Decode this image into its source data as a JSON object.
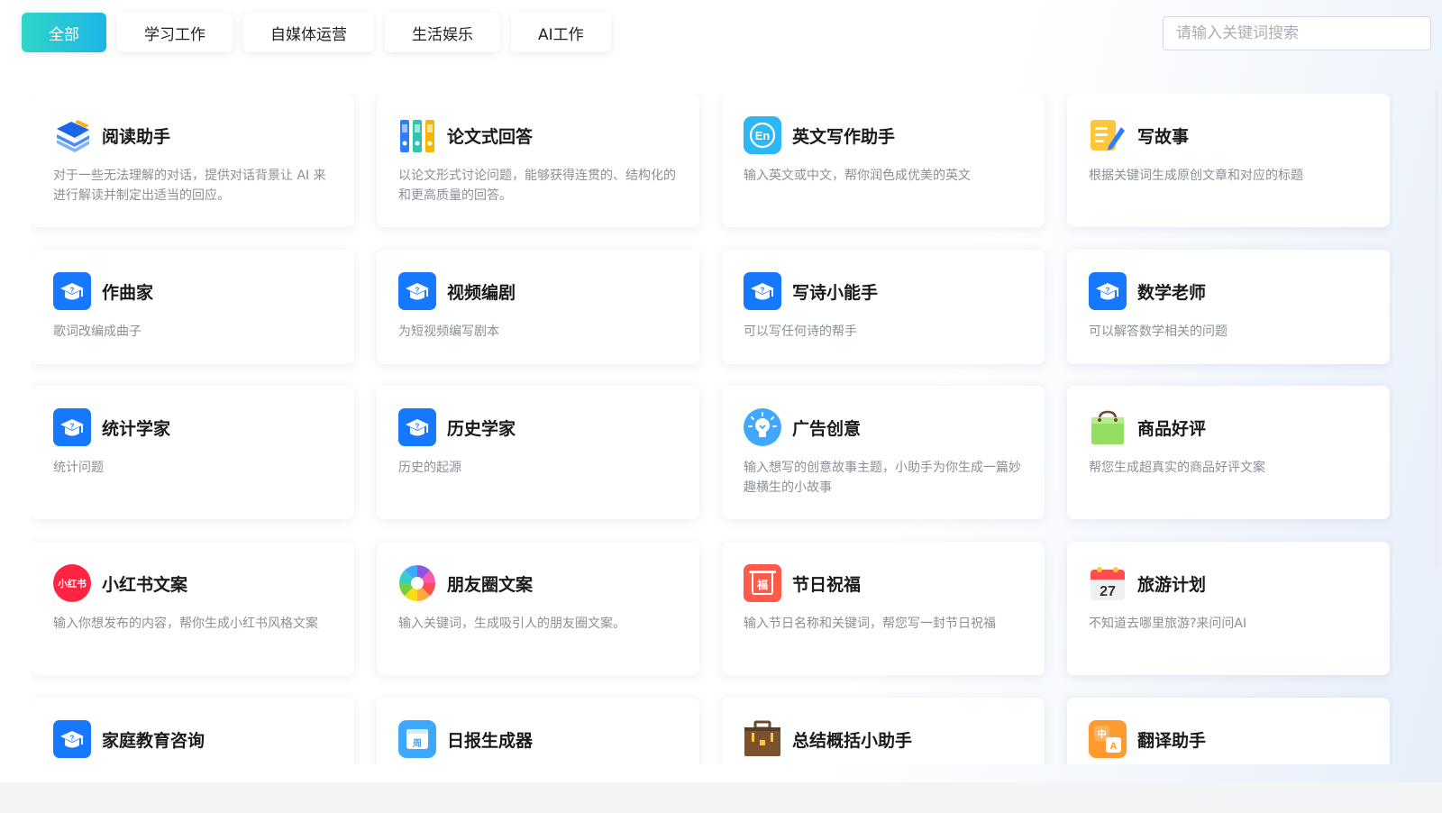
{
  "tabs": [
    {
      "label": "全部",
      "active": true
    },
    {
      "label": "学习工作",
      "active": false
    },
    {
      "label": "自媒体运营",
      "active": false
    },
    {
      "label": "生活娱乐",
      "active": false
    },
    {
      "label": "AI工作",
      "active": false
    }
  ],
  "search": {
    "placeholder": "请输入关键词搜索",
    "value": ""
  },
  "colors": {
    "tab_active_start": "#2fd6c8",
    "tab_active_end": "#1eb4e6",
    "icon_blue": "#1677ff",
    "title": "#1a1a1a",
    "desc": "#8a8f98"
  },
  "cards": [
    {
      "title": "阅读助手",
      "desc": "对于一些无法理解的对话，提供对话背景让 AI 来进行解读并制定出适当的回应。",
      "icon": "books-icon"
    },
    {
      "title": "论文式回答",
      "desc": "以论文形式讨论问题，能够获得连贯的、结构化的和更高质量的回答。",
      "icon": "binders-icon"
    },
    {
      "title": "英文写作助手",
      "desc": "输入英文或中文，帮你润色成优美的英文",
      "icon": "english-icon"
    },
    {
      "title": "写故事",
      "desc": "根据关键词生成原创文章和对应的标题",
      "icon": "notepad-pen-icon"
    },
    {
      "title": "作曲家",
      "desc": "歌词改编成曲子",
      "icon": "graduation-cap-icon"
    },
    {
      "title": "视频编剧",
      "desc": "为短视频编写剧本",
      "icon": "graduation-cap-icon"
    },
    {
      "title": "写诗小能手",
      "desc": "可以写任何诗的帮手",
      "icon": "graduation-cap-icon"
    },
    {
      "title": "数学老师",
      "desc": "可以解答数学相关的问题",
      "icon": "graduation-cap-icon"
    },
    {
      "title": "统计学家",
      "desc": "统计问题",
      "icon": "graduation-cap-icon"
    },
    {
      "title": "历史学家",
      "desc": "历史的起源",
      "icon": "graduation-cap-icon"
    },
    {
      "title": "广告创意",
      "desc": "输入想写的创意故事主题，小助手为你生成一篇妙趣横生的小故事",
      "icon": "lightbulb-icon"
    },
    {
      "title": "商品好评",
      "desc": "帮您生成超真实的商品好评文案",
      "icon": "shopping-bag-icon"
    },
    {
      "title": "小红书文案",
      "desc": "输入你想发布的内容，帮你生成小红书风格文案",
      "icon": "xiaohongshu-icon",
      "icon_text": "小红书"
    },
    {
      "title": "朋友圈文案",
      "desc": "输入关键词，生成吸引人的朋友圈文案。",
      "icon": "aperture-icon"
    },
    {
      "title": "节日祝福",
      "desc": "输入节日名称和关键词，帮您写一封节日祝福",
      "icon": "fu-blessing-icon",
      "icon_text": "福"
    },
    {
      "title": "旅游计划",
      "desc": "不知道去哪里旅游?来问问AI",
      "icon": "calendar-icon",
      "icon_text": "27"
    },
    {
      "title": "家庭教育咨询",
      "desc": "",
      "icon": "graduation-cap-icon"
    },
    {
      "title": "日报生成器",
      "desc": "",
      "icon": "weekly-calendar-icon",
      "icon_text": "周"
    },
    {
      "title": "总结概括小助手",
      "desc": "",
      "icon": "briefcase-icon"
    },
    {
      "title": "翻译助手",
      "desc": "",
      "icon": "translate-icon",
      "icon_text": "中A"
    }
  ]
}
